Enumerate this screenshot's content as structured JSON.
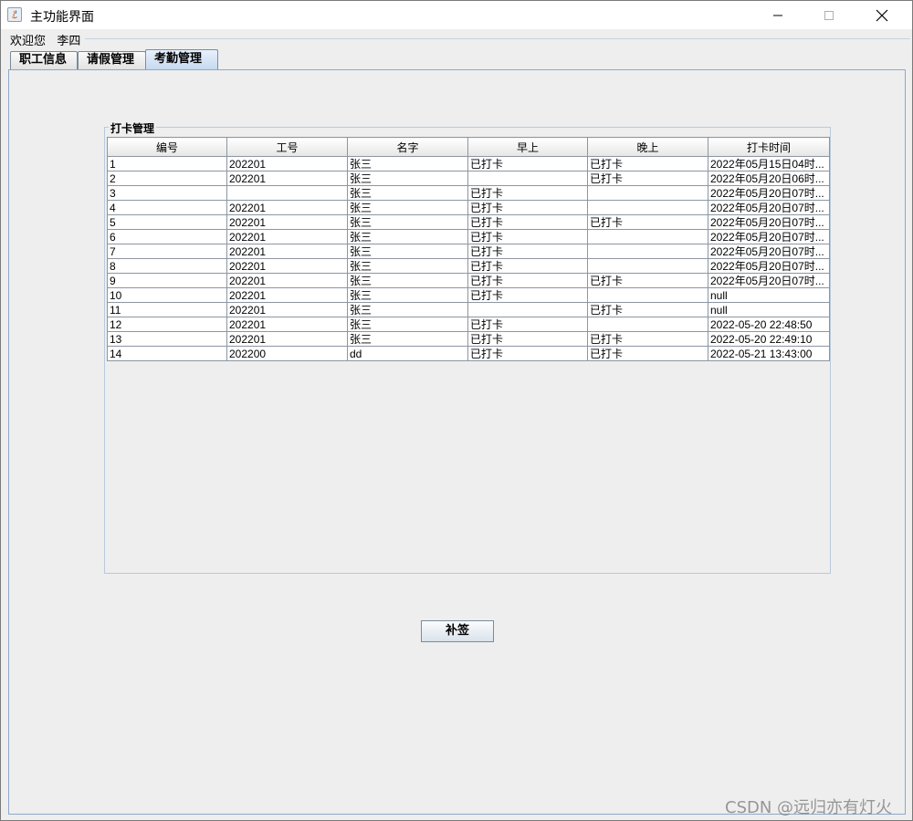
{
  "window": {
    "title": "主功能界面",
    "controls": {
      "minimize_icon": "minimize-icon",
      "maximize_icon": "maximize-icon",
      "close_icon": "close-icon"
    }
  },
  "header": {
    "welcome": "欢迎您   李四"
  },
  "tabs": [
    {
      "label": "职工信息",
      "selected": false
    },
    {
      "label": "请假管理",
      "selected": false
    },
    {
      "label": "考勤管理",
      "selected": true
    }
  ],
  "attendance": {
    "group_title": "打卡管理",
    "columns": [
      "编号",
      "工号",
      "名字",
      "早上",
      "晚上",
      "打卡时间"
    ],
    "rows": [
      [
        "1",
        "202201",
        "张三",
        "已打卡",
        "已打卡",
        "2022年05月15日04时..."
      ],
      [
        "2",
        "202201",
        "张三",
        "",
        "已打卡",
        "2022年05月20日06时..."
      ],
      [
        "3",
        "",
        "张三",
        "已打卡",
        "",
        "2022年05月20日07时..."
      ],
      [
        "4",
        "202201",
        "张三",
        "已打卡",
        "",
        "2022年05月20日07时..."
      ],
      [
        "5",
        "202201",
        "张三",
        "已打卡",
        "已打卡",
        "2022年05月20日07时..."
      ],
      [
        "6",
        "202201",
        "张三",
        "已打卡",
        "",
        "2022年05月20日07时..."
      ],
      [
        "7",
        "202201",
        "张三",
        "已打卡",
        "",
        "2022年05月20日07时..."
      ],
      [
        "8",
        "202201",
        "张三",
        "已打卡",
        "",
        "2022年05月20日07时..."
      ],
      [
        "9",
        "202201",
        "张三",
        "已打卡",
        "已打卡",
        "2022年05月20日07时..."
      ],
      [
        "10",
        "202201",
        "张三",
        "已打卡",
        "",
        "null"
      ],
      [
        "11",
        "202201",
        "张三",
        "",
        "已打卡",
        "null"
      ],
      [
        "12",
        "202201",
        "张三",
        "已打卡",
        "",
        "2022-05-20 22:48:50"
      ],
      [
        "13",
        "202201",
        "张三",
        "已打卡",
        "已打卡",
        "2022-05-20 22:49:10"
      ],
      [
        "14",
        "202200",
        "dd",
        "已打卡",
        "已打卡",
        "2022-05-21 13:43:00"
      ]
    ],
    "resign_button": "补签"
  },
  "watermark": "CSDN @远归亦有灯火"
}
